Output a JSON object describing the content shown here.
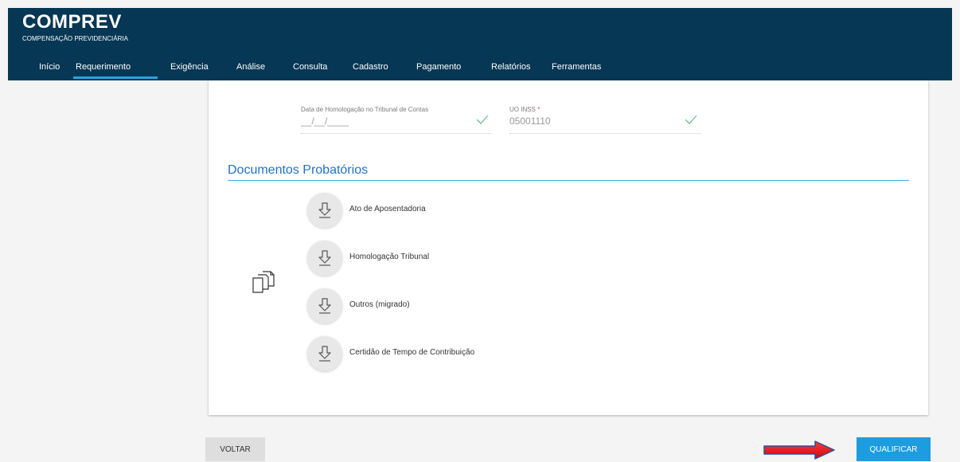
{
  "app": {
    "title": "COMPREV",
    "subtitle": "COMPENSAÇÃO PREVIDENCIÁRIA"
  },
  "nav": {
    "items": [
      {
        "label": "Início"
      },
      {
        "label": "Requerimento"
      },
      {
        "label": "Exigência"
      },
      {
        "label": "Análise"
      },
      {
        "label": "Consulta"
      },
      {
        "label": "Cadastro"
      },
      {
        "label": "Pagamento"
      },
      {
        "label": "Relatórios"
      },
      {
        "label": "Ferramentas"
      }
    ],
    "active": "Requerimento"
  },
  "form": {
    "homologacao": {
      "label": "Data de Homologação no Tribunal de Contas",
      "value": "__/__/____",
      "status_icon": "check-icon"
    },
    "uo_inss": {
      "label": "UO INSS",
      "required_mark": "*",
      "value": "05001110",
      "status_icon": "check-icon"
    }
  },
  "documents": {
    "title": "Documentos Probatórios",
    "section_icon": "documents-icon",
    "items": [
      {
        "label": "Ato de Aposentadoria",
        "icon": "download-icon"
      },
      {
        "label": "Homologação Tribunal",
        "icon": "download-icon"
      },
      {
        "label": "Outros (migrado)",
        "icon": "download-icon"
      },
      {
        "label": "Certidão de Tempo de Contribuição",
        "icon": "download-icon"
      }
    ]
  },
  "actions": {
    "back_label": "VOLTAR",
    "qualify_label": "QUALIFICAR"
  },
  "colors": {
    "header_bg": "#063754",
    "accent": "#1e9ce0",
    "section_title": "#1f72c8",
    "check": "#6cc28a",
    "arrow": "#e8131b"
  }
}
